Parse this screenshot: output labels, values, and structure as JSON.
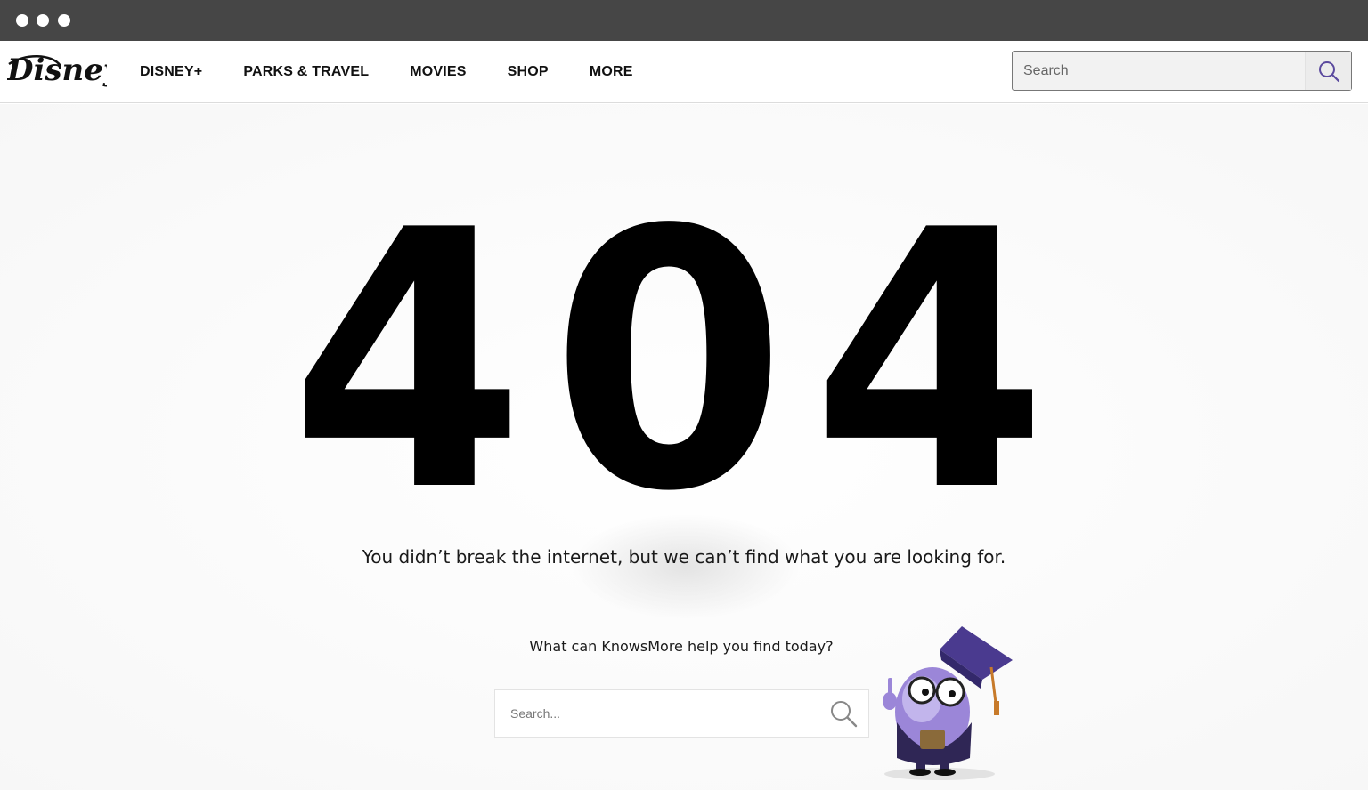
{
  "brand": {
    "logo_text": "Disney"
  },
  "nav": {
    "items": [
      {
        "label": "DISNEY+"
      },
      {
        "label": "PARKS & TRAVEL"
      },
      {
        "label": "MOVIES"
      },
      {
        "label": "SHOP"
      },
      {
        "label": "MORE"
      }
    ]
  },
  "top_search": {
    "placeholder": "Search",
    "icon": "search-icon"
  },
  "error": {
    "code": "404",
    "message": "You didn’t break the internet, but we can’t find what you are looking for."
  },
  "helper": {
    "prompt": "What can KnowsMore help you find today?",
    "search_placeholder": "Search...",
    "icon": "search-icon",
    "mascot": "knowsmore-mascot"
  },
  "colors": {
    "chrome": "#464646",
    "accent": "#5b4a9e",
    "text": "#111111"
  }
}
